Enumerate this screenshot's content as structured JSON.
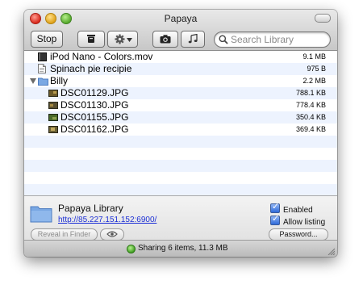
{
  "window": {
    "title": "Papaya"
  },
  "toolbar": {
    "stop_label": "Stop",
    "search_placeholder": "Search Library"
  },
  "files": [
    {
      "name": "iPod Nano - Colors.mov",
      "size": "9.1 MB",
      "icon": "movie-icon",
      "indent": 0
    },
    {
      "name": "Spinach pie recipie",
      "size": "975 B",
      "icon": "document-icon",
      "indent": 0
    },
    {
      "name": "Billy",
      "size": "2.2 MB",
      "icon": "folder-icon",
      "indent": 0,
      "expanded": true
    },
    {
      "name": "DSC01129.JPG",
      "size": "788.1 KB",
      "icon": "image-icon",
      "indent": 1
    },
    {
      "name": "DSC01130.JPG",
      "size": "778.4 KB",
      "icon": "image-icon",
      "indent": 1
    },
    {
      "name": "DSC01155.JPG",
      "size": "350.4 KB",
      "icon": "image-icon",
      "indent": 1
    },
    {
      "name": "DSC01162.JPG",
      "size": "369.4 KB",
      "icon": "image-icon",
      "indent": 1
    }
  ],
  "library": {
    "name": "Papaya Library",
    "url": "http://85.227.151.152:6900/",
    "enabled_label": "Enabled",
    "enabled": true,
    "allow_listing_label": "Allow listing",
    "allow_listing": true,
    "reveal_label": "Reveal in Finder",
    "password_label": "Password..."
  },
  "status": {
    "text": "Sharing 6 items, 11.3 MB",
    "color": "#3b9a1d"
  },
  "colors": {
    "row_alt": "#edf3fe",
    "link": "#1c2fd6",
    "folder": "#7aa8e3"
  }
}
